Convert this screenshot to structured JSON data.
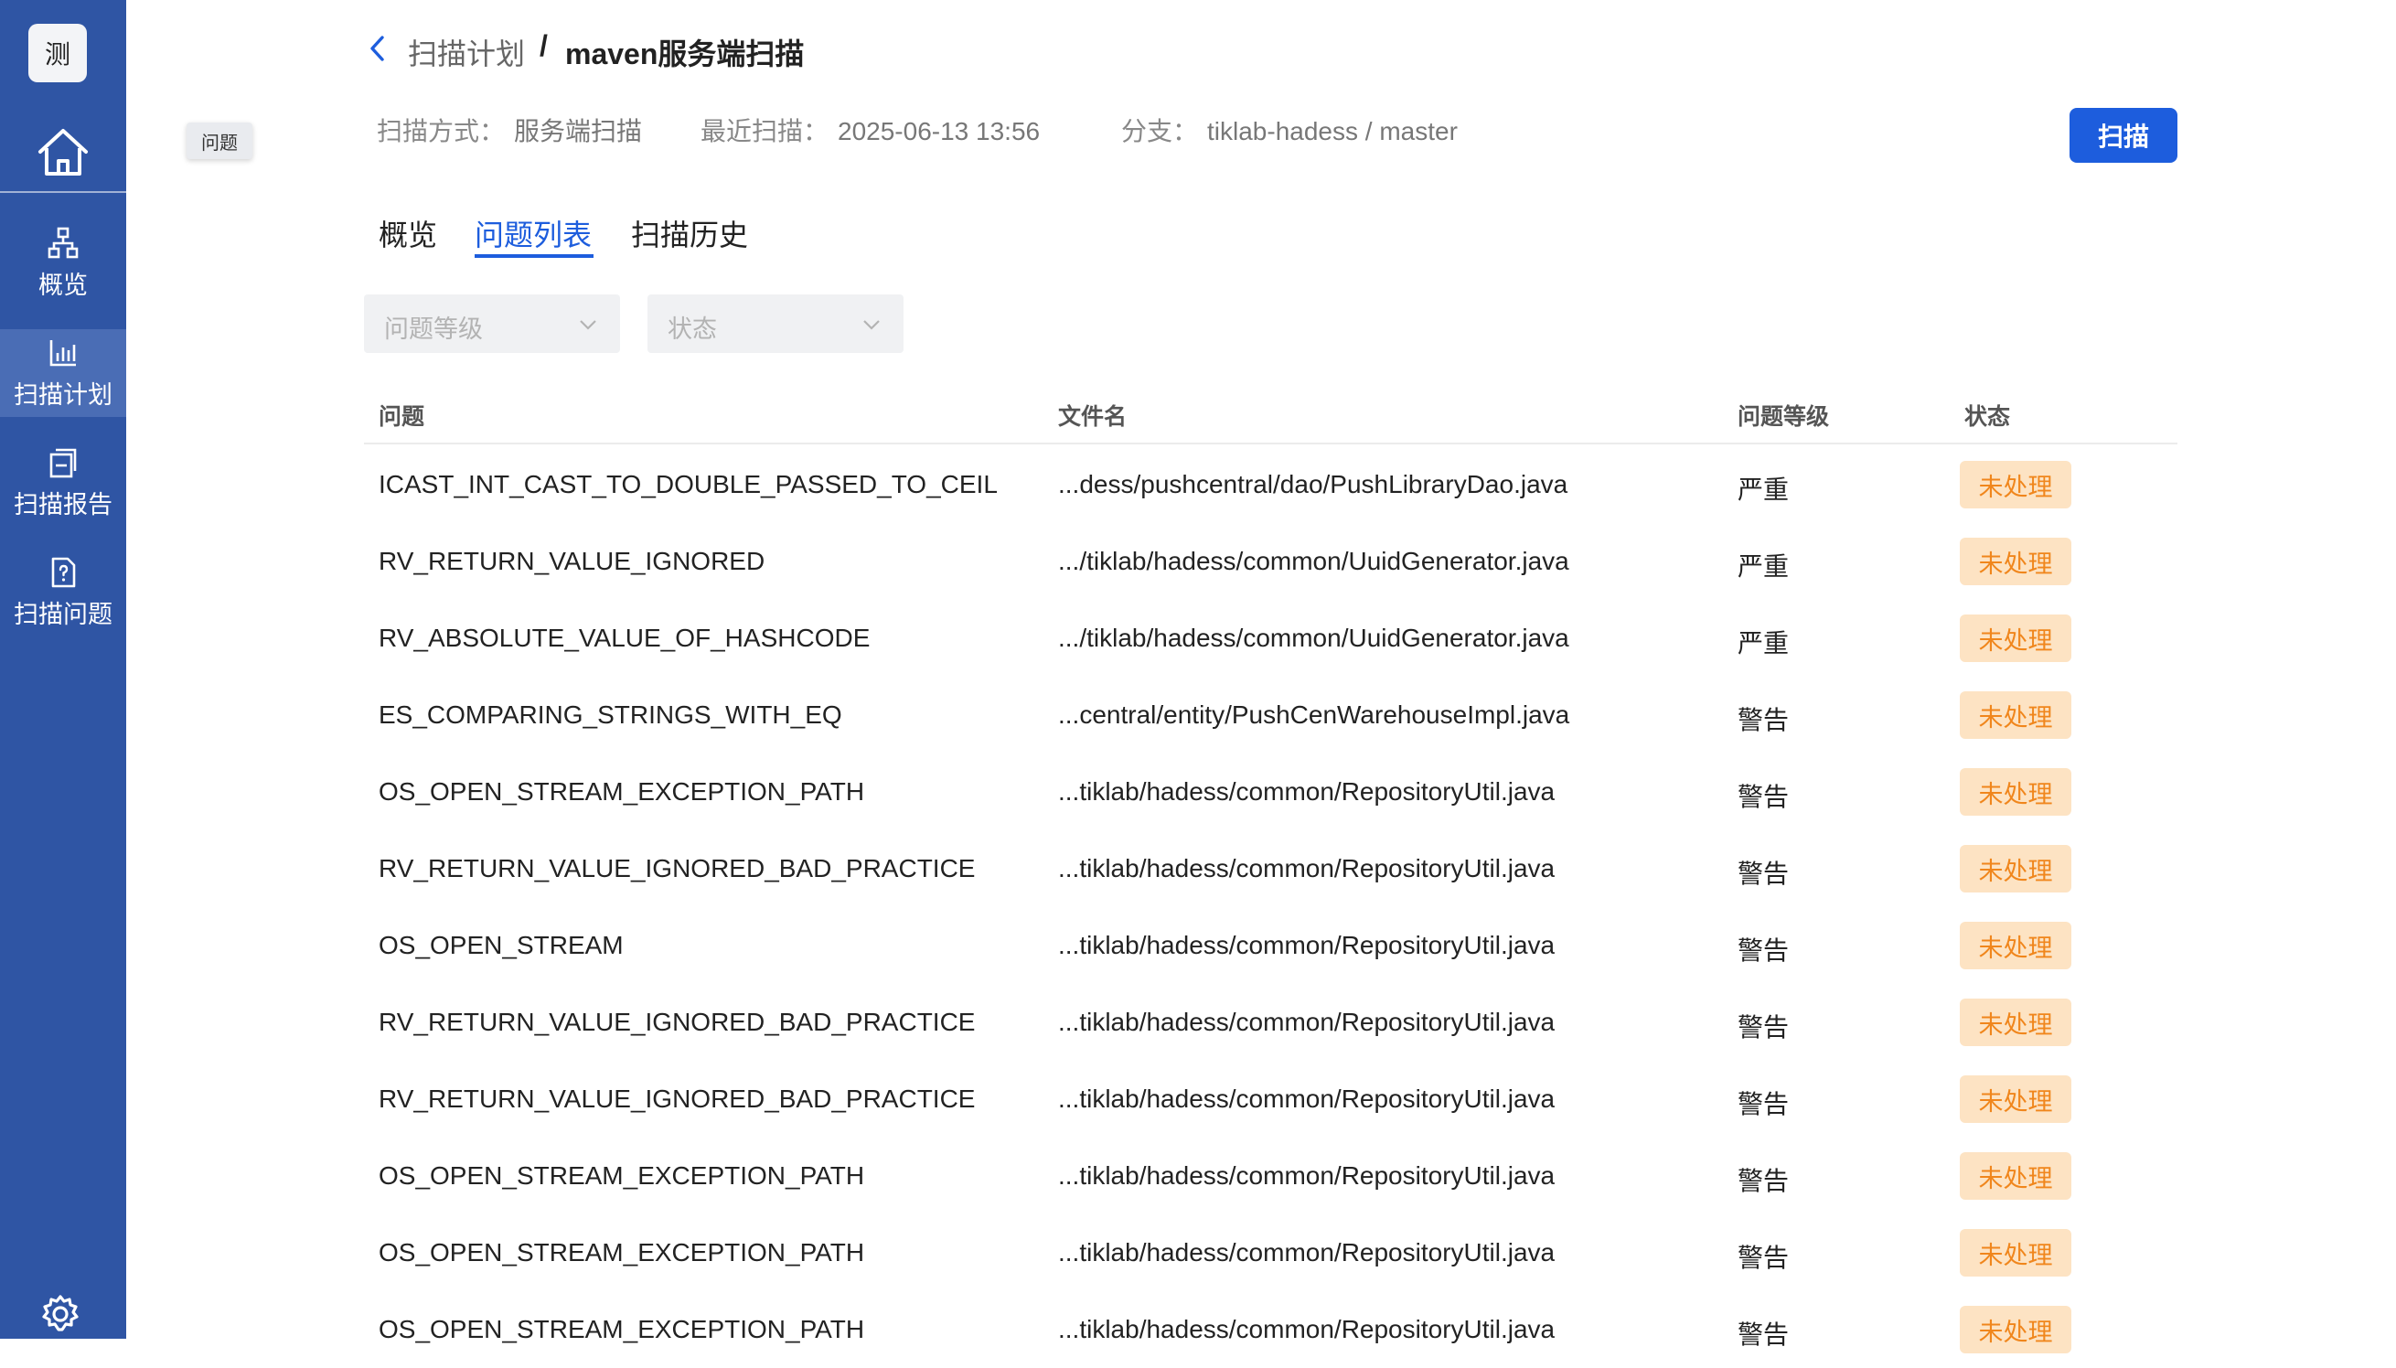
{
  "sidebar": {
    "logo": "测",
    "items": [
      {
        "label": "概览",
        "icon": "sitemap-icon"
      },
      {
        "label": "扫描计划",
        "icon": "bar-chart-icon"
      },
      {
        "label": "扫描报告",
        "icon": "report-icon"
      },
      {
        "label": "扫描问题",
        "icon": "question-file-icon"
      }
    ],
    "active_index": 1
  },
  "tooltip": "问题",
  "header": {
    "breadcrumb_parent": "扫描计划",
    "breadcrumb_sep": "/",
    "title": "maven服务端扫描",
    "scan_mode_label": "扫描方式：",
    "scan_mode_value": "服务端扫描",
    "last_scan_label": "最近扫描：",
    "last_scan_value": "2025-06-13 13:56",
    "branch_label": "分支：",
    "branch_value": "tiklab-hadess / master",
    "scan_button": "扫描"
  },
  "tabs": [
    {
      "label": "概览"
    },
    {
      "label": "问题列表"
    },
    {
      "label": "扫描历史"
    }
  ],
  "active_tab": 1,
  "filters": {
    "level_placeholder": "问题等级",
    "status_placeholder": "状态"
  },
  "table": {
    "columns": [
      "问题",
      "文件名",
      "问题等级",
      "状态"
    ],
    "rows": [
      {
        "issue": "ICAST_INT_CAST_TO_DOUBLE_PASSED_TO_CEIL",
        "file": "...dess/pushcentral/dao/PushLibraryDao.java",
        "level": "严重",
        "status": "未处理"
      },
      {
        "issue": "RV_RETURN_VALUE_IGNORED",
        "file": ".../tiklab/hadess/common/UuidGenerator.java",
        "level": "严重",
        "status": "未处理"
      },
      {
        "issue": "RV_ABSOLUTE_VALUE_OF_HASHCODE",
        "file": ".../tiklab/hadess/common/UuidGenerator.java",
        "level": "严重",
        "status": "未处理"
      },
      {
        "issue": "ES_COMPARING_STRINGS_WITH_EQ",
        "file": "...central/entity/PushCenWarehouseImpl.java",
        "level": "警告",
        "status": "未处理"
      },
      {
        "issue": "OS_OPEN_STREAM_EXCEPTION_PATH",
        "file": "...tiklab/hadess/common/RepositoryUtil.java",
        "level": "警告",
        "status": "未处理"
      },
      {
        "issue": "RV_RETURN_VALUE_IGNORED_BAD_PRACTICE",
        "file": "...tiklab/hadess/common/RepositoryUtil.java",
        "level": "警告",
        "status": "未处理"
      },
      {
        "issue": "OS_OPEN_STREAM",
        "file": "...tiklab/hadess/common/RepositoryUtil.java",
        "level": "警告",
        "status": "未处理"
      },
      {
        "issue": "RV_RETURN_VALUE_IGNORED_BAD_PRACTICE",
        "file": "...tiklab/hadess/common/RepositoryUtil.java",
        "level": "警告",
        "status": "未处理"
      },
      {
        "issue": "RV_RETURN_VALUE_IGNORED_BAD_PRACTICE",
        "file": "...tiklab/hadess/common/RepositoryUtil.java",
        "level": "警告",
        "status": "未处理"
      },
      {
        "issue": "OS_OPEN_STREAM_EXCEPTION_PATH",
        "file": "...tiklab/hadess/common/RepositoryUtil.java",
        "level": "警告",
        "status": "未处理"
      },
      {
        "issue": "OS_OPEN_STREAM_EXCEPTION_PATH",
        "file": "...tiklab/hadess/common/RepositoryUtil.java",
        "level": "警告",
        "status": "未处理"
      },
      {
        "issue": "OS_OPEN_STREAM_EXCEPTION_PATH",
        "file": "...tiklab/hadess/common/RepositoryUtil.java",
        "level": "警告",
        "status": "未处理"
      }
    ]
  },
  "colors": {
    "sidebar_bg": "#2f55a4",
    "sidebar_active": "#4a6db5",
    "accent": "#1d5ddd",
    "badge_bg": "#fde3c3",
    "badge_text": "#f0861c"
  }
}
